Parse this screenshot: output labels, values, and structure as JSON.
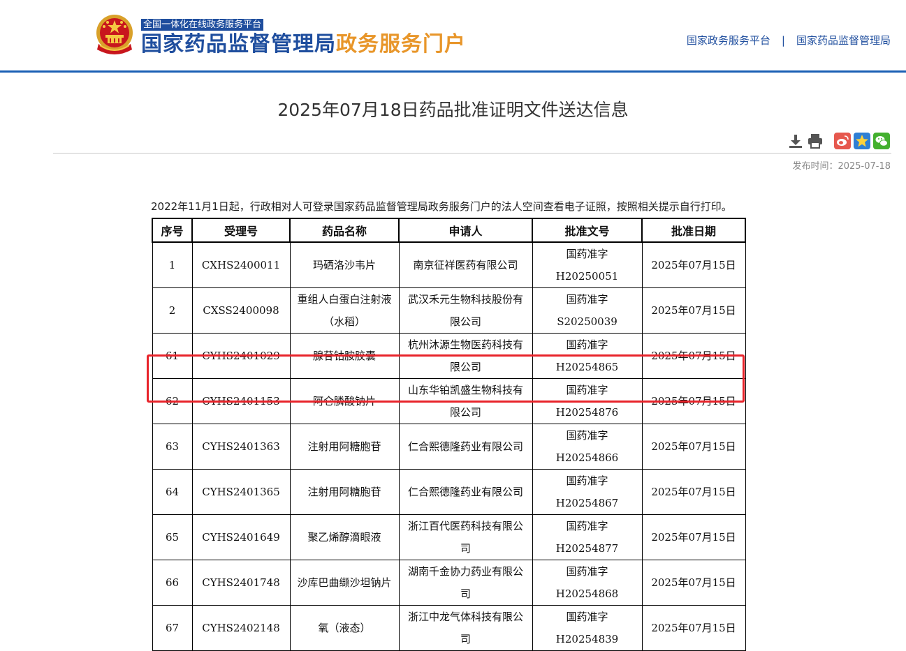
{
  "header": {
    "tagline": "全国一体化在线政务服务平台",
    "title_main": "国家药品监督管理局",
    "title_accent": "政务服务门户",
    "links": [
      "国家政务服务平台",
      "国家药品监督管理局"
    ],
    "link_separator": "|",
    "colors": {
      "brand_blue": "#1f4e9e",
      "accent_orange": "#e8962a",
      "header_rule": "#1a5fb4"
    }
  },
  "article": {
    "title": "2025年07月18日药品批准证明文件送达信息",
    "publish_label": "发布时间：2025-07-18",
    "toolbar_icons": [
      "download-icon",
      "print-icon",
      "weibo-icon",
      "qzone-icon",
      "wechat-icon"
    ],
    "intro": "2022年11月1日起，行政相对人可登录国家药品监督管理局政务服务门户的法人空间查看电子证照，按照相关提示自行打印。"
  },
  "table": {
    "headers": [
      "序号",
      "受理号",
      "药品名称",
      "申请人",
      "批准文号",
      "批准日期"
    ],
    "rows": [
      [
        "1",
        "CXHS2400011",
        "玛硒洛沙韦片",
        "南京征祥医药有限公司",
        "国药准字H20250051",
        "2025年07月15日"
      ],
      [
        "2",
        "CXSS2400098",
        "重组人白蛋白注射液（水稻）",
        "武汉禾元生物科技股份有限公司",
        "国药准字S20250039",
        "2025年07月15日"
      ],
      [
        "61",
        "CYHS2401029",
        "腺苷钴胺胶囊",
        "杭州沐源生物医药科技有限公司",
        "国药准字H20254865",
        "2025年07月15日"
      ],
      [
        "62",
        "CYHS2401153",
        "阿仑膦酸钠片",
        "山东华铂凯盛生物科技有限公司",
        "国药准字H20254876",
        "2025年07月15日"
      ],
      [
        "63",
        "CYHS2401363",
        "注射用阿糖胞苷",
        "仁合熙德隆药业有限公司",
        "国药准字H20254866",
        "2025年07月15日"
      ],
      [
        "64",
        "CYHS2401365",
        "注射用阿糖胞苷",
        "仁合熙德隆药业有限公司",
        "国药准字H20254867",
        "2025年07月15日"
      ],
      [
        "65",
        "CYHS2401649",
        "聚乙烯醇滴眼液",
        "浙江百代医药科技有限公司",
        "国药准字H20254877",
        "2025年07月15日"
      ],
      [
        "66",
        "CYHS2401748",
        "沙库巴曲缬沙坦钠片",
        "湖南千金协力药业有限公司",
        "国药准字H20254868",
        "2025年07月15日"
      ],
      [
        "67",
        "CYHS2402148",
        "氧（液态）",
        "浙江中龙气体科技有限公司",
        "国药准字H20254839",
        "2025年07月15日"
      ]
    ],
    "highlighted_row": "62",
    "highlight_color": "#e8232a"
  }
}
